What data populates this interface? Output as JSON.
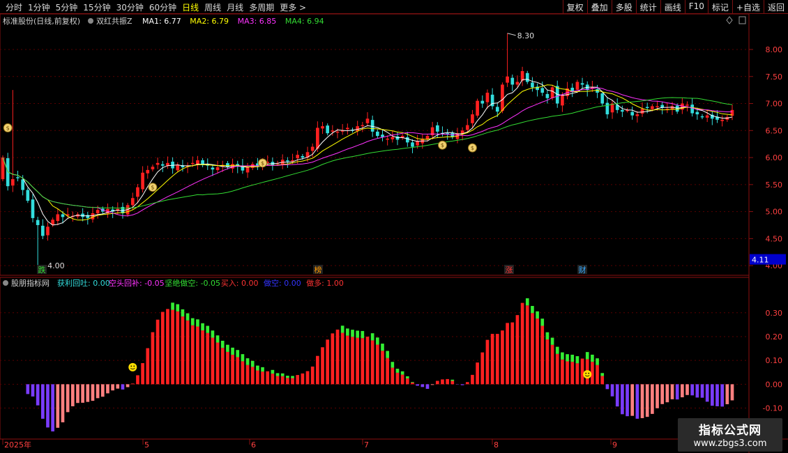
{
  "toolbar": {
    "periods": [
      "分时",
      "1分钟",
      "5分钟",
      "15分钟",
      "30分钟",
      "60分钟",
      "日线",
      "周线",
      "月线",
      "多周期",
      "更多 >"
    ],
    "active_period": "日线",
    "actions": [
      "复权",
      "叠加",
      "多股",
      "统计",
      "画线",
      "F10",
      "标记",
      "+自选",
      "返回"
    ]
  },
  "main_panel": {
    "title": "标准股份(日线,前复权)",
    "indicator_name": "双红共振Z",
    "ma_labels": [
      {
        "text": "MA1: 6.77",
        "color": "#ffffff"
      },
      {
        "text": "MA2: 6.79",
        "color": "#ffff00"
      },
      {
        "text": "MA3: 6.85",
        "color": "#ff33ff"
      },
      {
        "text": "MA4: 6.94",
        "color": "#33dd33"
      }
    ],
    "price_ticks": [
      "8.00",
      "7.50",
      "7.00",
      "6.50",
      "6.00",
      "5.50",
      "5.00",
      "4.50",
      "4.00"
    ],
    "current_price_label": "4.11",
    "high_label": "8.30",
    "low_label": "4.00",
    "signals": [
      {
        "text": "跌",
        "color": "#33dd33"
      },
      {
        "text": "榜",
        "color": "#ff9900"
      },
      {
        "text": "涨",
        "color": "#ff3333"
      },
      {
        "text": "财",
        "color": "#33aaff"
      }
    ]
  },
  "sub_panel": {
    "title": "股朋指标网",
    "values": [
      {
        "text": "获利回吐: 0.00",
        "color": "#33dddd"
      },
      {
        "text": "空头回补: -0.05",
        "color": "#ff33ff"
      },
      {
        "text": "坚绝做空: -0.05",
        "color": "#33dd33"
      },
      {
        "text": "买入: 0.00",
        "color": "#ff3333"
      },
      {
        "text": "做空: 0.00",
        "color": "#3333ff"
      },
      {
        "text": "做多: 1.00",
        "color": "#ff3333"
      }
    ],
    "ticks": [
      "0.30",
      "0.20",
      "0.10",
      "0.00",
      "-0.10"
    ]
  },
  "date_axis": [
    "2025年",
    "5",
    "6",
    "7",
    "8",
    "9"
  ],
  "watermark": {
    "line1": "指标公式网",
    "line2": "www.zbgs3.com"
  },
  "colors": {
    "up": "#ff2020",
    "down": "#33dddd",
    "frame": "#8b1010",
    "purple": "#7a3cff",
    "pink": "#ff8080",
    "green": "#33ee33"
  },
  "chart_data": {
    "type": "candlestick",
    "price_axis_range": [
      3.95,
      8.4
    ],
    "closes": [
      6.0,
      5.47,
      5.6,
      5.62,
      5.4,
      5.2,
      4.88,
      4.75,
      4.55,
      4.72,
      4.85,
      4.95,
      4.9,
      4.95,
      4.92,
      4.95,
      4.9,
      4.88,
      4.97,
      5.03,
      5.0,
      5.05,
      5.0,
      5.05,
      4.97,
      5.12,
      5.25,
      5.45,
      5.72,
      5.77,
      5.83,
      5.9,
      5.85,
      5.9,
      5.8,
      5.87,
      5.82,
      5.85,
      5.9,
      5.95,
      5.86,
      5.85,
      5.78,
      5.82,
      5.86,
      5.82,
      5.88,
      5.83,
      5.76,
      5.82,
      5.88,
      5.85,
      5.93,
      5.92,
      5.86,
      5.9,
      5.96,
      5.93,
      5.95,
      6.05,
      6.0,
      6.1,
      6.2,
      6.55,
      6.58,
      6.45,
      6.5,
      6.48,
      6.5,
      6.55,
      6.5,
      6.58,
      6.6,
      6.72,
      6.48,
      6.4,
      6.38,
      6.35,
      6.38,
      6.33,
      6.4,
      6.28,
      6.2,
      6.3,
      6.35,
      6.4,
      6.56,
      6.48,
      6.45,
      6.43,
      6.38,
      6.45,
      6.5,
      6.6,
      6.8,
      7.05,
      7.0,
      7.2,
      6.95,
      6.85,
      7.35,
      7.5,
      7.35,
      7.4,
      7.6,
      7.4,
      7.3,
      7.25,
      7.2,
      7.1,
      7.3,
      7.0,
      7.15,
      7.28,
      7.22,
      7.4,
      7.35,
      7.25,
      7.3,
      7.2,
      7.0,
      6.8,
      7.0,
      6.88,
      6.85,
      6.88,
      6.78,
      6.8,
      6.9,
      6.92,
      6.95,
      6.95,
      6.92,
      6.9,
      6.95,
      6.85,
      7.0,
      6.98,
      6.82,
      6.8,
      6.75,
      6.78,
      6.72,
      6.7,
      6.7,
      6.75,
      6.88
    ],
    "sub_series": [
      {
        "name": "做多",
        "color": "#ff2020"
      },
      {
        "name": "坚绝做空",
        "color": "#33ee33"
      },
      {
        "name": "空头回补",
        "color": "#7a3cff"
      }
    ],
    "sub_axis_range": [
      -0.23,
      0.39
    ]
  }
}
